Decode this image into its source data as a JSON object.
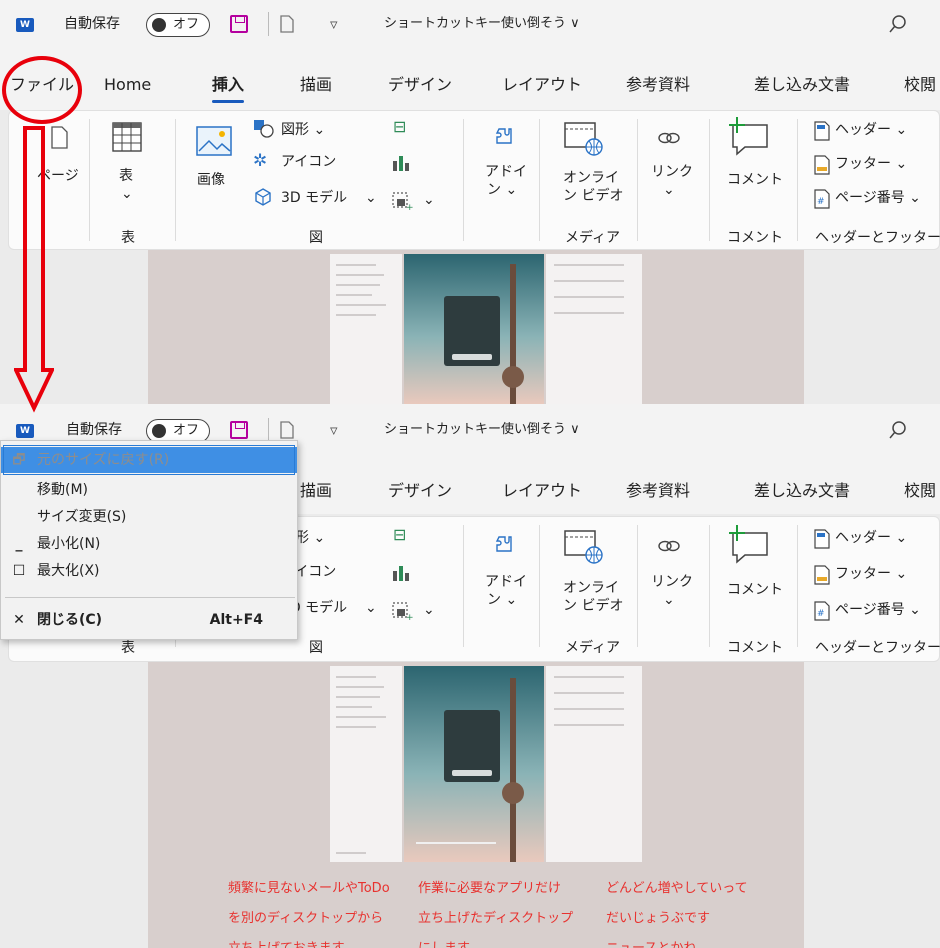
{
  "titlebar": {
    "app_icon_label": "W",
    "autosave_label": "自動保存",
    "autosave_state": "オフ",
    "customize_glyph": "▿",
    "doc_title": "ショートカットキー使い倒そう ∨",
    "search_icon": "search-icon"
  },
  "tabs": {
    "file": "ファイル",
    "home": "Home",
    "insert": "挿入",
    "draw": "描画",
    "design": "デザイン",
    "layout": "レイアウト",
    "references": "参考資料",
    "mailings": "差し込み文書",
    "review": "校閲"
  },
  "ribbon": {
    "page_label": "ページ",
    "table_label": "表",
    "table_chev": "⌄",
    "table_group": "表",
    "image_label": "画像",
    "shapes_label": "図形 ⌄",
    "icons_label": "アイコン",
    "model3d_label": "3D モデル",
    "illustrations_group": "図",
    "addins_label_1": "アドイ",
    "addins_label_2": "ン ⌄",
    "video_label_1": "オンライ",
    "video_label_2": "ン ビデオ",
    "media_group": "メディア",
    "link_label": "リンク",
    "link_chev": "⌄",
    "comment_label": "コメント",
    "comment_group": "コメント",
    "header_label": "ヘッダー ⌄",
    "footer_label": "フッター ⌄",
    "pagenum_label": "ページ番号 ⌄",
    "headerfooter_group": "ヘッダーとフッター"
  },
  "system_menu": {
    "restore": "元のサイズに戻す(R)",
    "move": "移動(M)",
    "size": "サイズ変更(S)",
    "minimize": "最小化(N)",
    "maximize": "最大化(X)",
    "close": "閉じる(C)",
    "close_shortcut": "Alt+F4"
  },
  "document": {
    "text_col1": "頻繁に見ないメールやToDo\nを別のディスクトップから\n立ち上げておきます",
    "text_col2": "作業に必要なアプリだけ\n立ち上げたディスクトップ\nにします",
    "text_col3": "どんどん増やしていって\nだいじょうぶです\nニュースとかね"
  },
  "colors": {
    "annotation_red": "#e8000b",
    "word_blue": "#185abd",
    "menu_highlight": "#3f8fe4",
    "doc_red_text": "#e8322f"
  }
}
